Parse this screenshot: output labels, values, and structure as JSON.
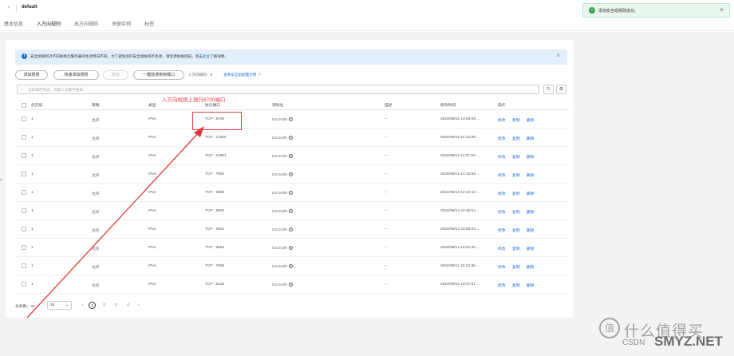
{
  "header": {
    "back_icon": "chevron-left-icon",
    "title": "default",
    "tabs": [
      "基本信息",
      "入方向规则",
      "出方向规则",
      "关联实例",
      "标签"
    ],
    "active_tab": 1
  },
  "toast": {
    "icon": "check-circle-icon",
    "message": "添加安全组规则成功。",
    "close_icon": "close-icon"
  },
  "banner": {
    "info_icon": "info-icon",
    "text": "安全组规则对不同规格云服务器的生效情况不同，为了避免您的安全组规则不生效，请您添加规则前，单击",
    "link": "此处",
    "suffix": "了解详情。",
    "close_icon": "close-icon"
  },
  "toolbar": {
    "add_rule": "添加规则",
    "quick_add": "快速添加规则",
    "delete": "删除",
    "one_click": "一键放通常用端口",
    "metric": "入方向规则：9",
    "metric_link": "查看安全组配置示例",
    "external_icon": "external-link-icon"
  },
  "search": {
    "placeholder": "选择属性筛选，或输入关键字搜索",
    "search_icon": "search-icon",
    "refresh_icon": "refresh-icon",
    "settings_icon": "gear-icon"
  },
  "table": {
    "columns": [
      "优先级",
      "策略",
      "类型",
      "协议端口",
      "源地址",
      "描述",
      "修改时间",
      "操作"
    ],
    "rows": [
      {
        "priority": "1",
        "policy": "允许",
        "type": "IPv4",
        "port": "TCP : 8700",
        "source": "0.0.0.0/0",
        "desc": "--",
        "time": "2024/09/16 13:55:08 ..."
      },
      {
        "priority": "1",
        "policy": "允许",
        "type": "IPv4",
        "port": "TCP : 11080",
        "source": "0.0.0.0/0",
        "desc": "--",
        "time": "2024/09/16 11:22:09 ..."
      },
      {
        "priority": "1",
        "policy": "允许",
        "type": "IPv4",
        "port": "TCP : 11081",
        "source": "0.0.0.0/0",
        "desc": "--",
        "time": "2024/09/16 11:21:53 ..."
      },
      {
        "priority": "1",
        "policy": "允许",
        "type": "IPv4",
        "port": "TCP : 7563",
        "source": "0.0.0.0/0",
        "desc": "--",
        "time": "2024/09/15 14:15:55 ..."
      },
      {
        "priority": "1",
        "policy": "允许",
        "type": "IPv4",
        "port": "TCP : 8993",
        "source": "0.0.0.0/0",
        "desc": "--",
        "time": "2024/09/15 14:14:42 ..."
      },
      {
        "priority": "1",
        "policy": "允许",
        "type": "IPv4",
        "port": "TCP : 8002",
        "source": "0.0.0.0/0",
        "desc": "--",
        "time": "2024/09/14 22:45:04 ..."
      },
      {
        "priority": "1",
        "policy": "允许",
        "type": "IPv4",
        "port": "TCP : 8001",
        "source": "0.0.0.0/0",
        "desc": "--",
        "time": "2024/09/14 20:05:03 ..."
      },
      {
        "priority": "1",
        "policy": "允许",
        "type": "IPv4",
        "port": "TCP : 8553",
        "source": "0.0.0.0/0",
        "desc": "--",
        "time": "2024/09/12 16:01:40 ..."
      },
      {
        "priority": "1",
        "policy": "允许",
        "type": "IPv4",
        "port": "TCP : 7565",
        "source": "0.0.0.0/0",
        "desc": "--",
        "time": "2024/09/11 15:24:38 ..."
      },
      {
        "priority": "1",
        "policy": "允许",
        "type": "IPv4",
        "port": "TCP : 8132",
        "source": "0.0.0.0/0",
        "desc": "--",
        "time": "2024/09/10 19:07:01 ..."
      }
    ],
    "actions": [
      "修改",
      "复制",
      "删除"
    ],
    "help_glyph": "?"
  },
  "pager": {
    "total": "总条数：30",
    "page_size": "10",
    "pages": [
      "1",
      "2",
      "3",
      "4"
    ],
    "current": "1",
    "prev": "‹",
    "next": "›"
  },
  "annotation": {
    "text": "入方向规则上放行8700端口",
    "color": "#e23b3b"
  },
  "watermark": {
    "logo": "值",
    "text": "什么值得买",
    "small": "CSDN",
    "site": "SMYZ.NET"
  }
}
